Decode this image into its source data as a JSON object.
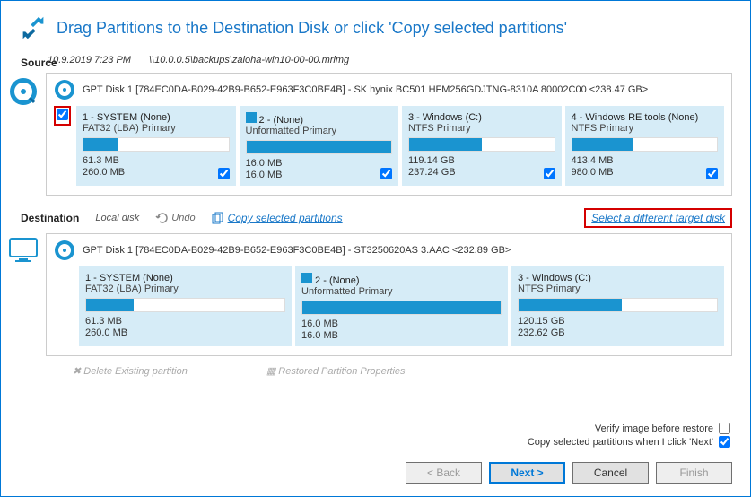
{
  "header": {
    "title": "Drag Partitions to the Destination Disk or click 'Copy selected partitions'"
  },
  "source": {
    "label": "Source",
    "timestamp": "10.9.2019 7:23 PM",
    "path": "\\\\10.0.0.5\\backups\\zaloha-win10-00-00.mrimg",
    "disk": "GPT Disk 1 [784EC0DA-B029-42B9-B652-E963F3C0BE4B] - SK hynix BC501 HFM256GDJTNG-8310A 80002C00  <238.47 GB>",
    "parts": [
      {
        "t1": "1 - SYSTEM (None)",
        "t2": "FAT32 (LBA) Primary",
        "used": "61.3 MB",
        "total": "260.0 MB",
        "pct": 24,
        "chk": true
      },
      {
        "t1": "2 -  (None)",
        "t2": "Unformatted Primary",
        "used": "16.0 MB",
        "total": "16.0 MB",
        "pct": 100,
        "chk": true,
        "win": true
      },
      {
        "t1": "3 - Windows (C:)",
        "t2": "NTFS Primary",
        "used": "119.14 GB",
        "total": "237.24 GB",
        "pct": 50,
        "chk": true
      },
      {
        "t1": "4 - Windows RE tools (None)",
        "t2": "NTFS Primary",
        "used": "413.4 MB",
        "total": "980.0 MB",
        "pct": 42,
        "chk": true
      }
    ]
  },
  "dest": {
    "label": "Destination",
    "local": "Local disk",
    "undo": "Undo",
    "copy": "Copy selected partitions",
    "select": "Select a different target disk",
    "disk": "GPT Disk 1 [784EC0DA-B029-42B9-B652-E963F3C0BE4B] - ST3250620AS 3.AAC  <232.89 GB>",
    "parts": [
      {
        "t1": "1 - SYSTEM (None)",
        "t2": "FAT32 (LBA) Primary",
        "used": "61.3 MB",
        "total": "260.0 MB",
        "pct": 24
      },
      {
        "t1": "2 -  (None)",
        "t2": "Unformatted Primary",
        "used": "16.0 MB",
        "total": "16.0 MB",
        "pct": 100,
        "win": true
      },
      {
        "t1": "3 - Windows (C:)",
        "t2": "NTFS Primary",
        "used": "120.15 GB",
        "total": "232.62 GB",
        "pct": 52
      }
    ]
  },
  "mid": {
    "del": "Delete Existing partition",
    "props": "Restored Partition Properties"
  },
  "opts": {
    "verify": "Verify image before restore",
    "copynext": "Copy selected partitions when I click 'Next'"
  },
  "btn": {
    "back": "< Back",
    "next": "Next >",
    "cancel": "Cancel",
    "finish": "Finish"
  }
}
